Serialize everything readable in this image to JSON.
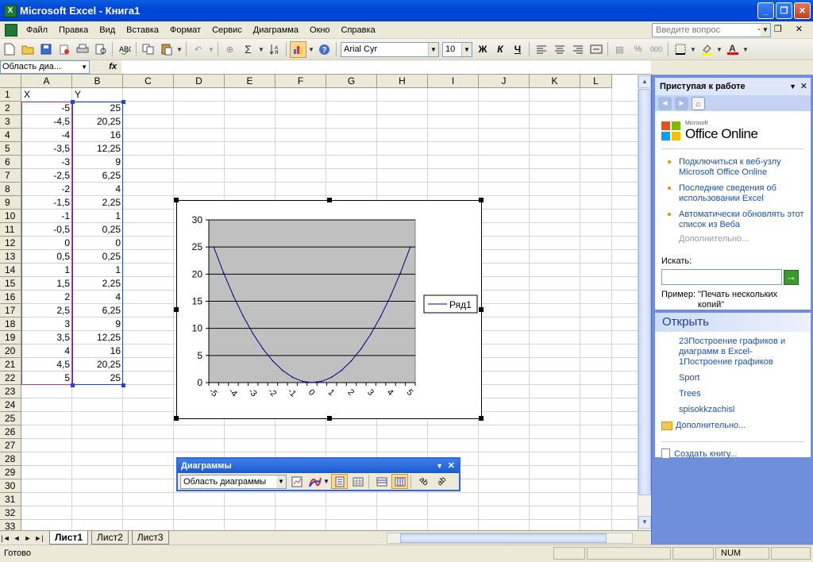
{
  "window": {
    "title": "Microsoft Excel - Книга1",
    "app_icon": "X"
  },
  "window_buttons": {
    "minimize": "_",
    "maximize": "❐",
    "close": "✕"
  },
  "menu": {
    "items": [
      "Файл",
      "Правка",
      "Вид",
      "Вставка",
      "Формат",
      "Сервис",
      "Диаграмма",
      "Окно",
      "Справка"
    ],
    "help_placeholder": "Введите вопрос",
    "right_controls": "- ❐ ✕"
  },
  "toolbar": {
    "font_name": "Arial Cyr",
    "font_size": "10",
    "bold": "Ж",
    "italic": "К",
    "underline": "Ч",
    "percent": "%",
    "thousands": "000",
    "sigma": "Σ",
    "font_color_letter": "A"
  },
  "formula_bar": {
    "name_box": "Область диа...",
    "fx": "fx",
    "content": ""
  },
  "columns": [
    "A",
    "B",
    "C",
    "D",
    "E",
    "F",
    "G",
    "H",
    "I",
    "J",
    "K",
    "L"
  ],
  "rows": [
    "1",
    "2",
    "3",
    "4",
    "5",
    "6",
    "7",
    "8",
    "9",
    "10",
    "11",
    "12",
    "13",
    "14",
    "15",
    "16",
    "17",
    "18",
    "19",
    "20",
    "21",
    "22",
    "23",
    "24",
    "25",
    "26",
    "27",
    "28",
    "29",
    "30",
    "31",
    "32",
    "33"
  ],
  "table": {
    "header_x": "X",
    "header_y": "Y",
    "x": [
      "-5",
      "-4,5",
      "-4",
      "-3,5",
      "-3",
      "-2,5",
      "-2",
      "-1,5",
      "-1",
      "-0,5",
      "0",
      "0,5",
      "1",
      "1,5",
      "2",
      "2,5",
      "3",
      "3,5",
      "4",
      "4,5",
      "5"
    ],
    "y": [
      "25",
      "20,25",
      "16",
      "12,25",
      "9",
      "6,25",
      "4",
      "2,25",
      "1",
      "0,25",
      "0",
      "0,25",
      "1",
      "2,25",
      "4",
      "6,25",
      "9",
      "12,25",
      "16",
      "20,25",
      "25"
    ]
  },
  "chart_data": {
    "type": "line",
    "title": "",
    "xlabel": "",
    "ylabel": "",
    "categories": [
      "-5",
      "-4,5",
      "-4",
      "-3,5",
      "-3",
      "-2,5",
      "-2",
      "-1,5",
      "-1",
      "-0,5",
      "0",
      "0,5",
      "1",
      "1,5",
      "2",
      "2,5",
      "3",
      "3,5",
      "4",
      "4,5",
      "5"
    ],
    "x_tick_labels": [
      "-5",
      "-4",
      "-3",
      "-2",
      "-1",
      "0",
      "1",
      "2",
      "3",
      "4",
      "5"
    ],
    "y_ticks": [
      "0",
      "5",
      "10",
      "15",
      "20",
      "25",
      "30"
    ],
    "ylim": [
      0,
      30
    ],
    "series": [
      {
        "name": "Ряд1",
        "values": [
          25,
          20.25,
          16,
          12.25,
          9,
          6.25,
          4,
          2.25,
          1,
          0.25,
          0,
          0.25,
          1,
          2.25,
          4,
          6.25,
          9,
          12.25,
          16,
          20.25,
          25
        ]
      }
    ],
    "plot_background": "#c0c0c0",
    "line_color": "#000080",
    "grid": true,
    "legend_position": "right"
  },
  "sheet_tabs": [
    "Лист1",
    "Лист2",
    "Лист3"
  ],
  "tab_nav": [
    "|◄",
    "◄",
    "►",
    "►|"
  ],
  "status": {
    "text": "Готово",
    "num": "NUM"
  },
  "task_pane": {
    "title": "Приступая к работе",
    "logo_small": "Microsoft",
    "logo": "Office Online",
    "links": [
      "Подключиться к веб-узлу Microsoft Office Online",
      "Последние сведения об использовании Excel",
      "Автоматически обновлять этот список из Веба"
    ],
    "more": "Дополнительно...",
    "search_label": "Искать:",
    "search_value": "",
    "example_label": "Пример:",
    "example_text": "\"Печать нескольких копий\"",
    "open_title": "Открыть",
    "files": [
      "23Построение графиков и диаграмм в Excel-1Построение графиков",
      "Sport",
      "Trees",
      "spisokkzachisl"
    ],
    "open_more": "Дополнительно...",
    "new_book": "Создать книгу..."
  },
  "chart_toolbar": {
    "title": "Диаграммы",
    "dropdown": "Область диаграммы"
  }
}
